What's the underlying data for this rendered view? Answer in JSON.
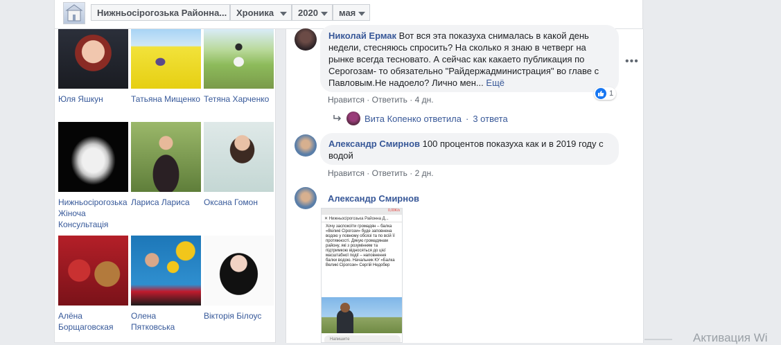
{
  "topbar": {
    "page_name": "Нижньосірогозька Районна...",
    "section": "Хроника",
    "year": "2020",
    "month": "мая"
  },
  "friends": [
    {
      "name": "Юля Яшкун",
      "icon": "profile-photo-woman-red-hair"
    },
    {
      "name": "Татьяна Мищенко",
      "icon": "profile-photo-rapeseed-field"
    },
    {
      "name": "Тетяна Харченко",
      "icon": "profile-photo-orchard"
    },
    {
      "name": "Нижньосірогозька Жіноча Консультація",
      "icon": "profile-photo-baby-cloth"
    },
    {
      "name": "Лариса Лариса",
      "icon": "profile-photo-woman-field"
    },
    {
      "name": "Оксана Гомон",
      "icon": "profile-photo-stay-home-frame"
    },
    {
      "name": "Алёна Борщаговская",
      "icon": "profile-photo-teddy-bear"
    },
    {
      "name": "Олена Пятковська",
      "icon": "profile-photo-sunflowers"
    },
    {
      "name": "Вікторія Білоус",
      "icon": "profile-photo-woman-dark-hair"
    }
  ],
  "comments": [
    {
      "author": "Николай Ермак",
      "text": "Вот вся эта показуха снималась в какой день недели, стесняюсь спросить? На сколько я знаю в четверг на рынке всегда тесновато. А сейчас как какаето публикация по Серогозам- то обязательно \"Райдержадминистрация\" во главе с Павловым.Не надоело? Лично мен...",
      "more": "Ещё",
      "like": "Нравится",
      "reply": "Ответить",
      "time": "4 дн.",
      "reactions": "1"
    },
    {
      "author": "Александр Смирнов",
      "text": "100 процентов показуха как и в 2019 году с водой",
      "like": "Нравится",
      "reply": "Ответить",
      "time": "2 дн."
    },
    {
      "author": "Александр Смирнов"
    }
  ],
  "replies_line": {
    "replier": "Вита Копенко ответила",
    "count": "3 ответа"
  },
  "sep": "·",
  "screenshot_attachment": {
    "status": "0,00K/s",
    "header": "Нижньосірогозька Районна Д...",
    "text": "Хочу заспокоїти громадян – балка «Великі Сірогози» буде заповнена водою у повному обсязі та по всій її протяжності. Дякую громадянам району, які з розумінням та підтримкою відносяться до цієї масштабної події – наповнення балки водою. Начальник КУ «Балка Великі Сірогози» Сергій Недобер",
    "input_placeholder": "Напишите"
  },
  "watermark": "Активация Wi"
}
